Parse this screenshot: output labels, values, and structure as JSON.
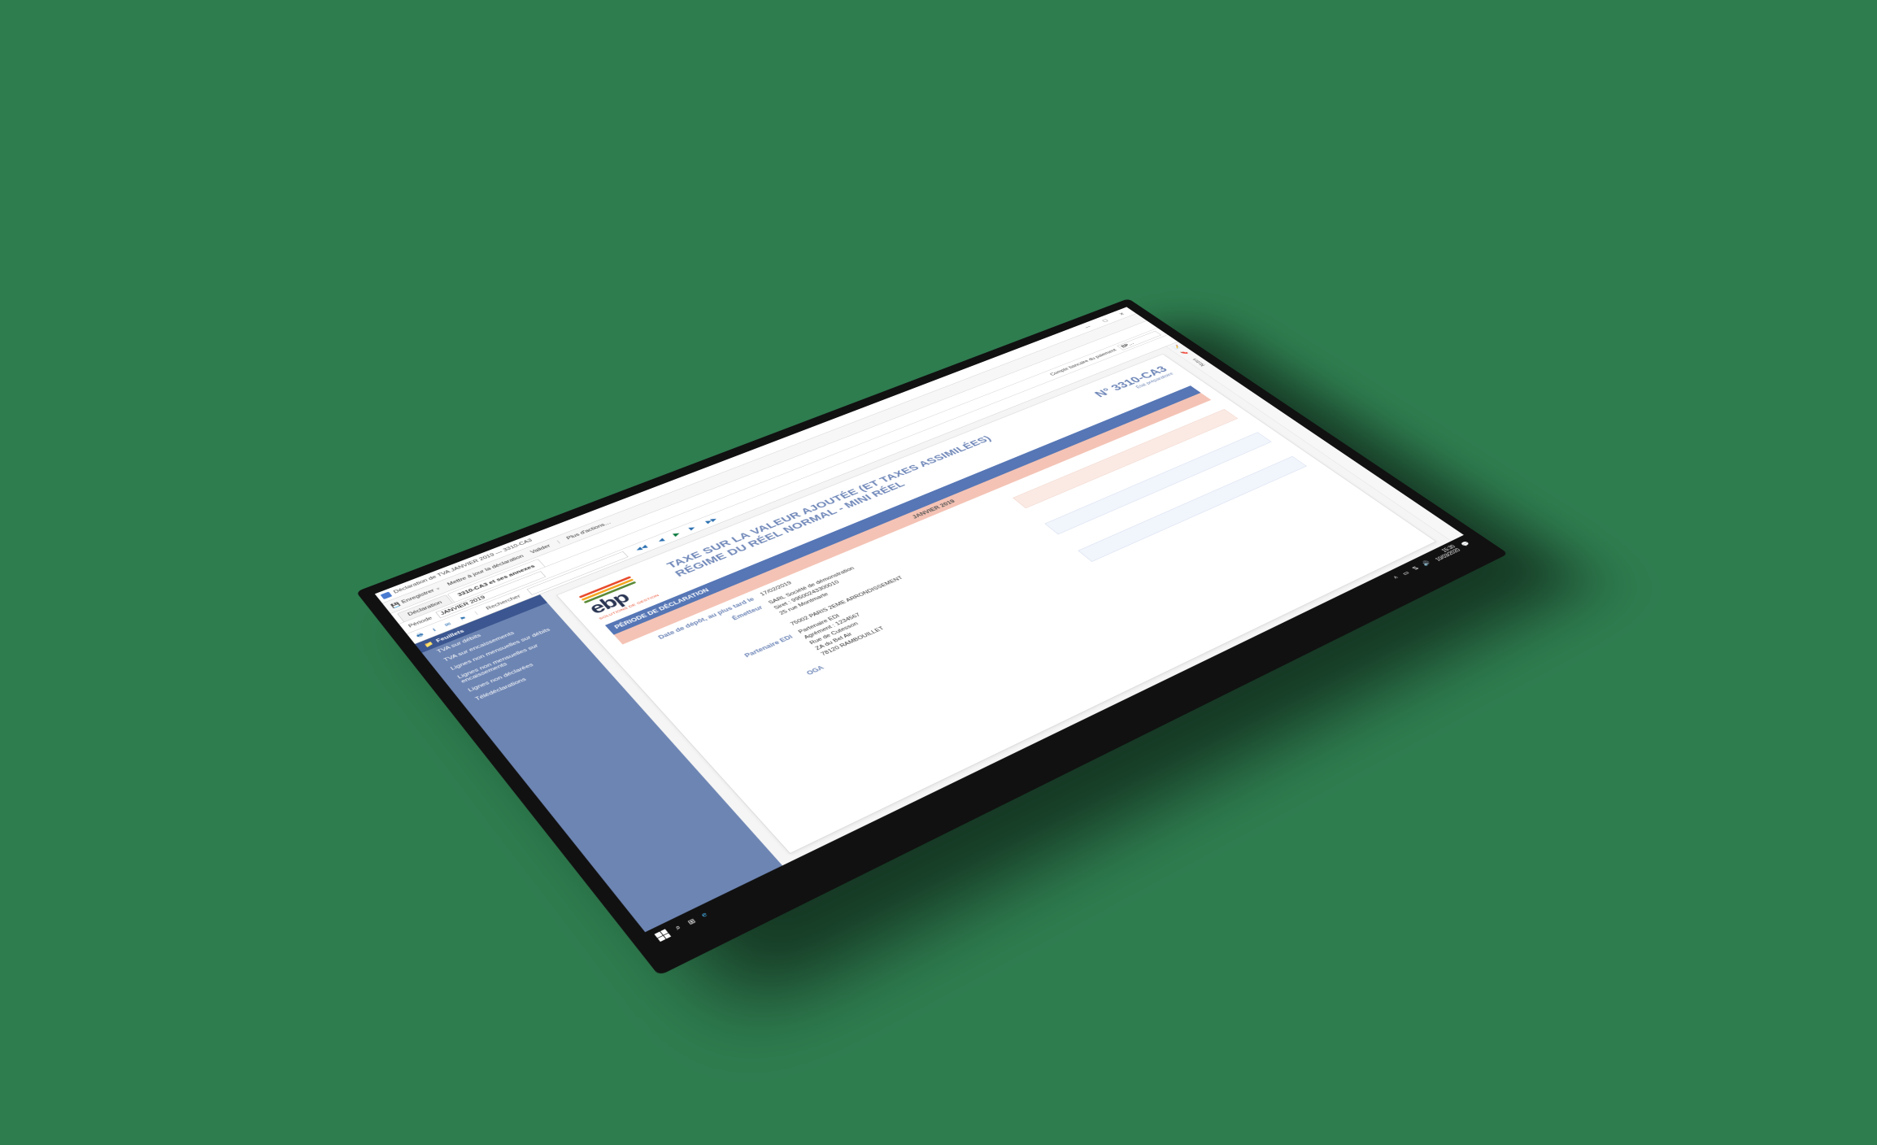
{
  "window": {
    "title": "Déclaration de TVA JANVIER 2019 — 3310-CA3"
  },
  "toolbar": {
    "save": "Enregistrer",
    "update": "Mettre à jour la déclaration",
    "validate": "Valider",
    "more": "Plus d'actions…"
  },
  "tabs": {
    "main": "Déclaration",
    "active": "3310-CA3 et ses annexes"
  },
  "period_row": {
    "label": "Période",
    "value": "JANVIER 2019",
    "account_label": "Compte bancaire du paiement",
    "account_value": "BP…"
  },
  "subtab": {
    "search_label": "Rechercher",
    "nav_first": "◀◀",
    "nav_prev": "◀",
    "nav_next": "▶",
    "nav_last": "▶▶"
  },
  "sidebar": {
    "header": "Feuillets",
    "items": [
      {
        "label": "TVA sur débits"
      },
      {
        "label": "TVA sur encaissements"
      },
      {
        "label": "Lignes non mensuelles sur débits"
      },
      {
        "label": "Lignes non mensuelles sur encaissements"
      },
      {
        "label": "Lignes non déclarées"
      },
      {
        "label": "Télédéclarations"
      }
    ]
  },
  "rside": {
    "label": "Notes"
  },
  "doc": {
    "logo_brand": "ebp",
    "logo_sub": "Solutions de gestion",
    "title1": "TAXE SUR LA VALEUR AJOUTÉE (ET TAXES ASSIMILÉES)",
    "title2": "RÉGIME DU RÉEL NORMAL - MINI RÉEL",
    "form_no": "N° 3310-CA3",
    "form_state": "État préparatoire",
    "section_period": "PÉRIODE DE DÉCLARATION",
    "period_value": "JANVIER 2019",
    "rows": {
      "depot_label": "Date de dépôt, au plus tard le",
      "depot_value": "17/02/2019",
      "emetteur_label": "Émetteur",
      "emetteur_value": "SARL Société de démonstration\nSiret : 99500243300010\n25 rue Montmarte\n \n75002 PARIS 2EME ARRONDISSEMENT",
      "edi_label": "Partenaire EDI",
      "edi_value": "Partenaire EDI\nAgrément : 1234567\nRue de Cutesson\nZA du Bel Air\n78120 RAMBOUILLET",
      "oga_label": "OGA"
    }
  },
  "taskbar": {
    "time": "15:30",
    "date": "10/03/2020"
  }
}
